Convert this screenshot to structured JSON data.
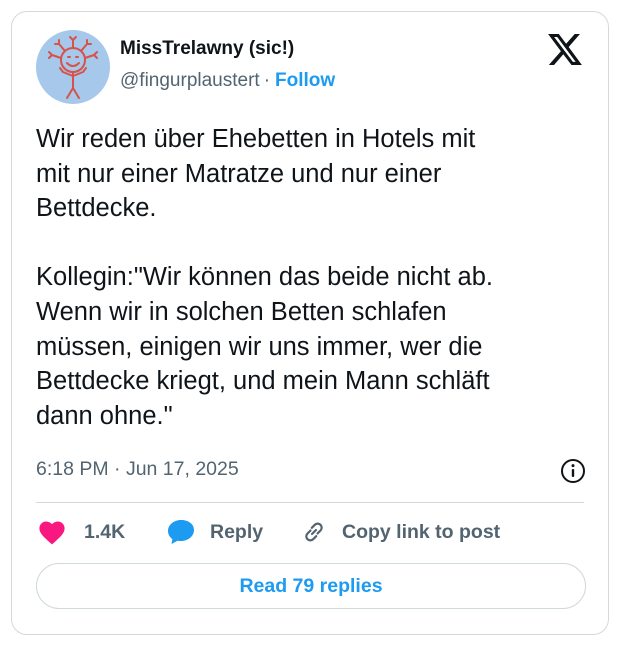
{
  "author": {
    "display_name": "MissTrelawny (sic!)",
    "handle": "@fingurplaustert",
    "separator": "·",
    "follow_label": "Follow",
    "avatar_color": "#a6c8ea",
    "avatar_drawing_color": "#d6524a"
  },
  "brand": {
    "icon": "x-logo-icon"
  },
  "tweet": {
    "text": "Wir reden über Ehebetten in Hotels mit\nmit nur einer Matratze und nur einer\nBettdecke.\n\nKollegin:\"Wir können das beide nicht ab.\nWenn wir in solchen Betten schlafen\nmüssen, einigen wir uns immer, wer die\nBettdecke kriegt, und mein Mann schläft\ndann ohne.\"",
    "timestamp": "6:18 PM · Jun 17, 2025",
    "info_icon": "info-circle-icon"
  },
  "actions": {
    "like": {
      "icon": "heart-icon",
      "count": "1.4K",
      "color": "#f91880"
    },
    "reply": {
      "icon": "speech-bubble-icon",
      "label": "Reply",
      "color": "#1d9bf0"
    },
    "copy": {
      "icon": "link-icon",
      "label": "Copy link to post"
    }
  },
  "footer": {
    "read_replies_label": "Read 79 replies"
  },
  "colors": {
    "text": "#0f1419",
    "secondary": "#536471",
    "accent": "#1d9bf0",
    "border": "#cfd9de"
  }
}
